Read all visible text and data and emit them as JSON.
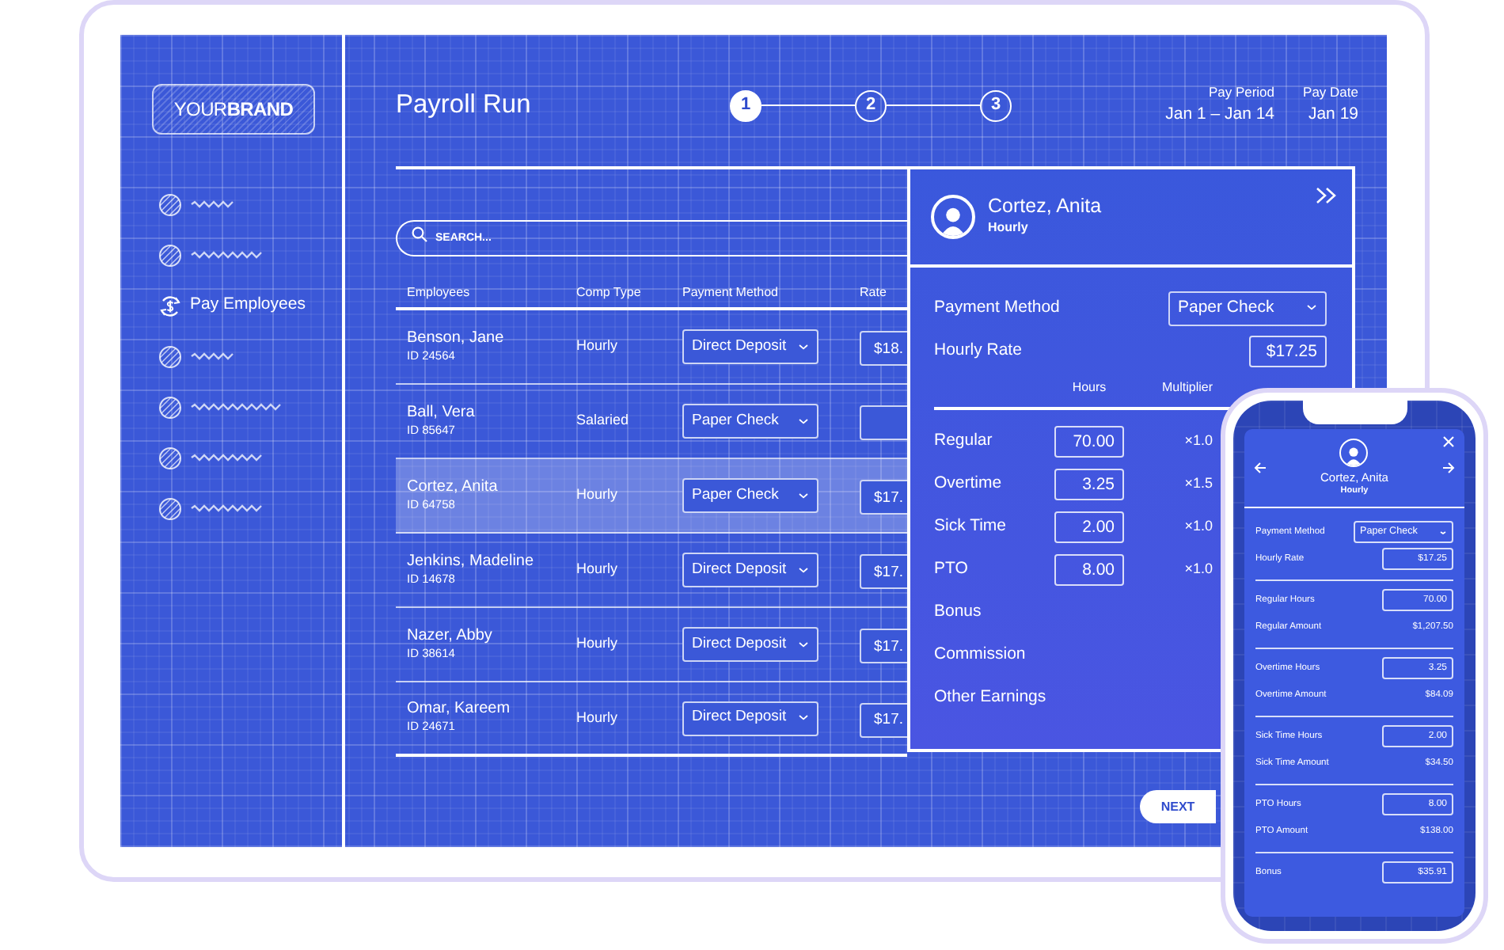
{
  "sidebar": {
    "brand": "YOUR**BRAND**",
    "items": [
      {
        "kind": "placeholder"
      },
      {
        "kind": "placeholder"
      },
      {
        "kind": "link",
        "label": "Pay Employees"
      },
      {
        "kind": "placeholder"
      },
      {
        "kind": "placeholder"
      },
      {
        "kind": "placeholder"
      },
      {
        "kind": "placeholder"
      }
    ]
  },
  "header": {
    "title": "Payroll Run",
    "steps": [
      {
        "label": "1",
        "selected": true
      },
      {
        "label": "2",
        "selected": false
      },
      {
        "label": "3",
        "selected": false
      }
    ],
    "pay_period": {
      "label": "Pay Period",
      "value": "Jan 1 – Jan 14"
    },
    "pay_date": {
      "label": "Pay Date",
      "value": "Jan 19"
    }
  },
  "search": {
    "placeholder": "SEARCH..."
  },
  "table": {
    "columns": [
      "Employees",
      "Comp Type",
      "Payment Method",
      "Rate"
    ],
    "rows": [
      {
        "name": "Benson, Jane",
        "id": "ID 24564",
        "comp_type": "Hourly",
        "payment_method": "Direct Deposit",
        "rate": "$18.",
        "selected": false
      },
      {
        "name": "Ball, Vera",
        "id": "ID 85647",
        "comp_type": "Salaried",
        "payment_method": "Paper Check",
        "selected": false
      },
      {
        "name": "Cortez, Anita",
        "id": "ID 64758",
        "comp_type": "Hourly",
        "payment_method": "Paper Check",
        "rate": "$17.",
        "selected": true
      },
      {
        "name": "Jenkins, Madeline",
        "id": "ID 14678",
        "comp_type": "Hourly",
        "payment_method": "Direct Deposit",
        "rate": "$17.",
        "selected": false
      },
      {
        "name": "Nazer, Abby",
        "id": "ID 38614",
        "comp_type": "Hourly",
        "payment_method": "Direct Deposit",
        "rate": "$17.",
        "selected": false
      },
      {
        "name": "Omar, Kareem",
        "id": "ID 24671",
        "comp_type": "Hourly",
        "payment_method": "Direct Deposit",
        "rate": "$17.",
        "selected": false
      }
    ]
  },
  "panel": {
    "name": "Cortez, Anita",
    "comp_type": "Hourly",
    "payment_method_label": "Payment Method",
    "payment_method": "Paper Check",
    "rate_label": "Hourly Rate",
    "rate": "$17.25",
    "columns": [
      "Hours",
      "Multiplier"
    ],
    "earnings": [
      {
        "kind": "hours",
        "label": "Regular",
        "hours": "70.00",
        "multiplier": "×1.0"
      },
      {
        "kind": "hours",
        "label": "Overtime",
        "hours": "3.25",
        "multiplier": "×1.5"
      },
      {
        "kind": "hours",
        "label": "Sick Time",
        "hours": "2.00",
        "multiplier": "×1.0"
      },
      {
        "kind": "hours",
        "label": "PTO",
        "hours": "8.00",
        "multiplier": "×1.0"
      },
      {
        "kind": "plain",
        "label": "Bonus"
      },
      {
        "kind": "plain",
        "label": "Commission"
      },
      {
        "kind": "plain",
        "label": "Other Earnings"
      }
    ]
  },
  "next_button": "NEXT",
  "phone": {
    "name": "Cortez, Anita",
    "comp_type": "Hourly",
    "sections": [
      [
        {
          "kind": "select",
          "label": "Payment Method",
          "value": "Paper Check"
        },
        {
          "kind": "input",
          "label": "Hourly Rate",
          "value": "$17.25"
        }
      ],
      [
        {
          "kind": "input",
          "label": "Regular Hours",
          "value": "70.00"
        },
        {
          "kind": "amount",
          "label": "Regular Amount",
          "value": "$1,207.50"
        }
      ],
      [
        {
          "kind": "input",
          "label": "Overtime Hours",
          "value": "3.25"
        },
        {
          "kind": "amount",
          "label": "Overtime Amount",
          "value": "$84.09"
        }
      ],
      [
        {
          "kind": "input",
          "label": "Sick Time Hours",
          "value": "2.00"
        },
        {
          "kind": "amount",
          "label": "Sick Time Amount",
          "value": "$34.50"
        }
      ],
      [
        {
          "kind": "input",
          "label": "PTO Hours",
          "value": "8.00"
        },
        {
          "kind": "amount",
          "label": "PTO Amount",
          "value": "$138.00"
        }
      ],
      [
        {
          "kind": "input",
          "label": "Bonus",
          "value": "$35.91"
        }
      ]
    ]
  }
}
